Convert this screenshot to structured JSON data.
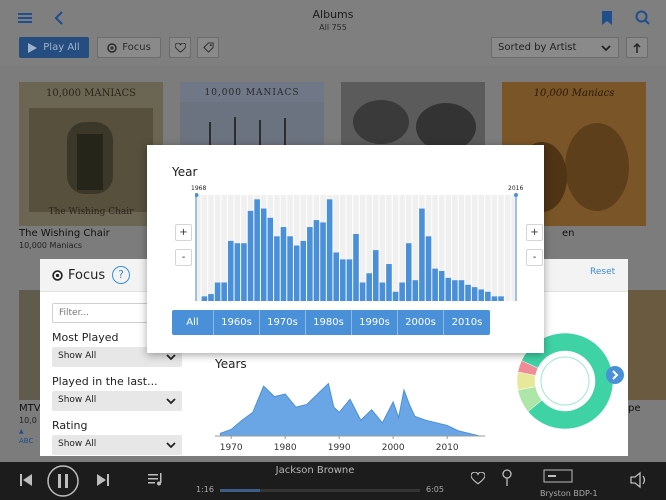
{
  "header": {
    "title": "Albums",
    "subtitle": "All 755",
    "play_all_label": "Play All",
    "focus_label": "Focus",
    "sort_label": "Sorted by Artist"
  },
  "albums": [
    {
      "title": "The Wishing Chair",
      "artist": "10,000 Maniacs",
      "cover_text": "10,000 MANIACS",
      "cover_subtext": "The Wishing Chair"
    },
    {
      "title": "",
      "artist": "",
      "cover_text": "10,000 MANIACS"
    },
    {
      "title": "",
      "artist": "",
      "cover_text": ""
    },
    {
      "title": "en",
      "artist": "",
      "cover_text": "10,000 Maniacs"
    }
  ],
  "partial_album": {
    "title": "MTV",
    "artist": "10,0",
    "index_letters": "ABC",
    "right_text": "pe"
  },
  "focus": {
    "title": "Focus",
    "help": "?",
    "reset_label": "Reset",
    "filter_placeholder": "Filter...",
    "most_played_label": "Most Played",
    "most_played_value": "Show All",
    "played_in_last_label": "Played in the last...",
    "played_in_last_value": "Show All",
    "rating_label": "Rating",
    "rating_value": "Show All",
    "years_title": "Years"
  },
  "year_popup": {
    "title": "Year",
    "min_label": "1968",
    "max_label": "2016",
    "plus": "+",
    "minus": "-",
    "decades": [
      "All",
      "1960s",
      "1970s",
      "1980s",
      "1990s",
      "2000s",
      "2010s"
    ]
  },
  "player": {
    "track": "Jackson Browne",
    "elapsed": "1:16",
    "remaining": "6:05",
    "progress": 0.2,
    "device": "Bryston BDP-1"
  },
  "chart_data": [
    {
      "type": "bar",
      "x": [
        1968,
        1969,
        1970,
        1971,
        1972,
        1973,
        1974,
        1975,
        1976,
        1977,
        1978,
        1979,
        1980,
        1981,
        1982,
        1983,
        1984,
        1985,
        1986,
        1987,
        1988,
        1989,
        1990,
        1991,
        1992,
        1993,
        1994,
        1995,
        1996,
        1997,
        1998,
        1999,
        2000,
        2001,
        2002,
        2003,
        2004,
        2005,
        2006,
        2007,
        2008,
        2009,
        2010,
        2011,
        2012,
        2013,
        2014,
        2015,
        2016
      ],
      "values": [
        0,
        2,
        3,
        8,
        8,
        26,
        25,
        25,
        39,
        44,
        40,
        36,
        28,
        32,
        28,
        24,
        26,
        32,
        35,
        34,
        44,
        21,
        18,
        18,
        29,
        8,
        12,
        22,
        8,
        16,
        4,
        8,
        25,
        9,
        40,
        28,
        14,
        13,
        10,
        9,
        9,
        7,
        6,
        5,
        4,
        2,
        2,
        0,
        0
      ],
      "ylim": [
        0,
        45
      ]
    },
    {
      "type": "area",
      "x": [
        1968,
        1970,
        1972,
        1974,
        1976,
        1978,
        1980,
        1982,
        1984,
        1986,
        1988,
        1989,
        1990,
        1992,
        1994,
        1996,
        1998,
        2000,
        2001,
        2002,
        2003,
        2004,
        2006,
        2008,
        2010,
        2012,
        2014,
        2016
      ],
      "values": [
        2,
        5,
        12,
        18,
        38,
        30,
        32,
        22,
        24,
        32,
        40,
        22,
        18,
        28,
        12,
        20,
        10,
        26,
        14,
        35,
        24,
        15,
        12,
        10,
        8,
        4,
        2,
        0
      ],
      "xticks": [
        1970,
        1980,
        1990,
        2000,
        2010
      ],
      "xlim": [
        1967,
        2017
      ],
      "ylim": [
        0,
        45
      ]
    },
    {
      "type": "pie",
      "values": [
        82,
        8,
        6,
        4
      ],
      "colors": [
        "#3ed2a5",
        "#aee5a9",
        "#e7e89a",
        "#f08c96"
      ]
    }
  ],
  "colors": {
    "accent": "#4a90d9",
    "header_blue": "#254d7f",
    "player_bg": "#1c1c1c"
  }
}
